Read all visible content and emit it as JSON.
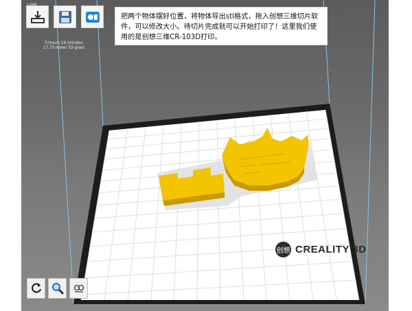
{
  "toolbar": {
    "load_label": "Load",
    "buttons": [
      {
        "name": "load",
        "icon": "load-icon"
      },
      {
        "name": "save",
        "icon": "save-icon"
      },
      {
        "name": "creality",
        "icon": "creality-app-icon"
      }
    ]
  },
  "print_info": {
    "time": "5 hours 19 minutes",
    "material": "17.73 meter 53 gram"
  },
  "caption": {
    "text": "把两个物体摆好位置，将物体导出stl格式，拖入创想三维切片软件，可以修改大小。待切片完成就可以开始打印了！这里我们使用的是创想三维CR-103D打印。"
  },
  "brand": {
    "logo_glyph": "创想",
    "name": "CREALITY 3D"
  },
  "bottom_tools": [
    {
      "name": "rotate",
      "icon": "rotate-icon"
    },
    {
      "name": "zoom",
      "icon": "magnifier-icon"
    },
    {
      "name": "view",
      "icon": "view-mode-icon"
    }
  ],
  "colors": {
    "model": "#f4c400",
    "model_shade": "#c99a00",
    "bed": "#ffffff",
    "grid": "#d4d4d4",
    "frame": "#1c1c1c",
    "build_lines": "#7fc6ee"
  }
}
